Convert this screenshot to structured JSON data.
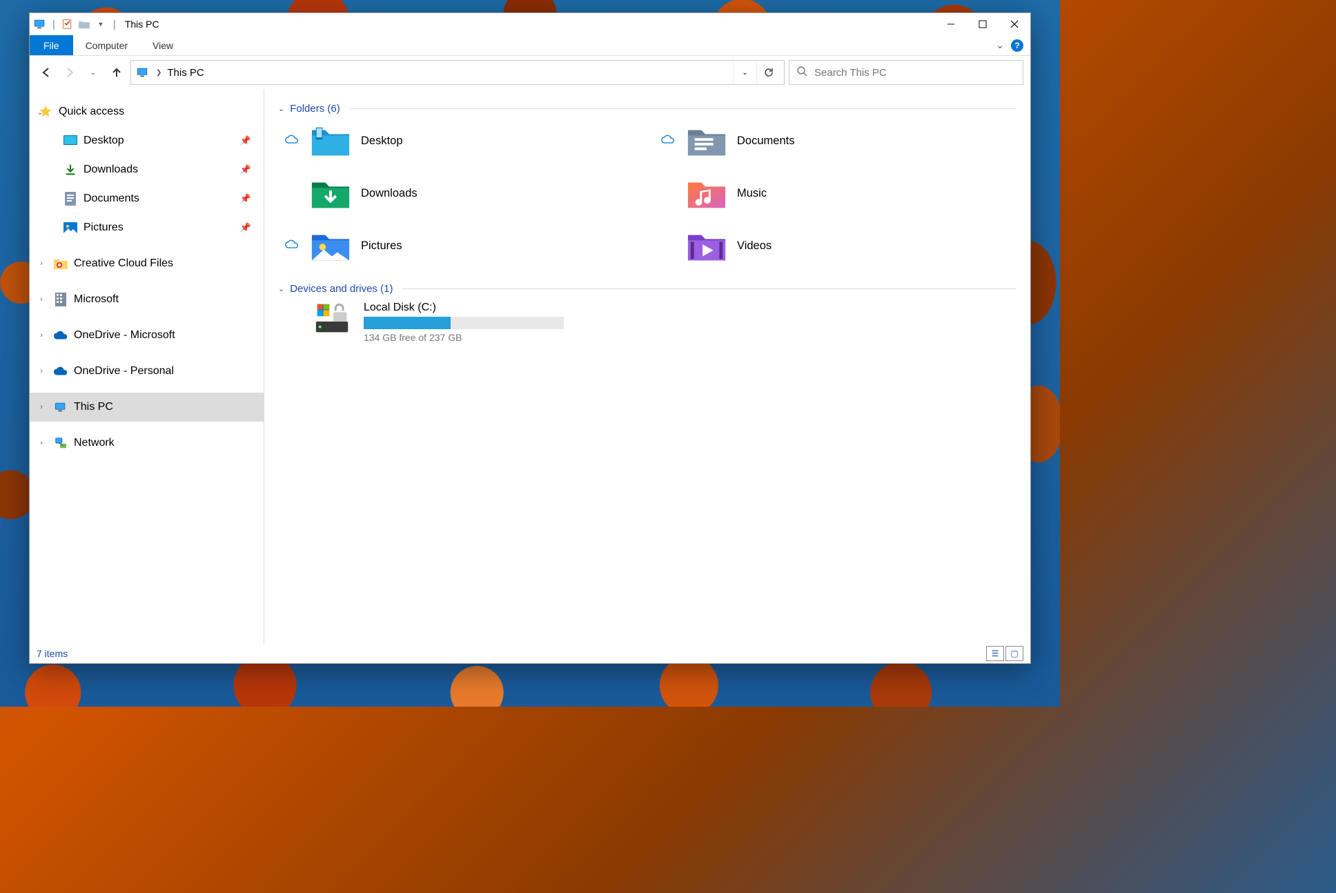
{
  "titlebar": {
    "title": "This PC"
  },
  "ribbon": {
    "file": "File",
    "tabs": [
      "Computer",
      "View"
    ]
  },
  "nav": {
    "breadcrumb": "This PC",
    "search_placeholder": "Search This PC"
  },
  "sidebar": {
    "quick_access": {
      "label": "Quick access",
      "items": [
        {
          "label": "Desktop",
          "icon": "desktop",
          "pinned": true
        },
        {
          "label": "Downloads",
          "icon": "downloads",
          "pinned": true
        },
        {
          "label": "Documents",
          "icon": "documents",
          "pinned": true
        },
        {
          "label": "Pictures",
          "icon": "pictures",
          "pinned": true
        }
      ]
    },
    "roots": [
      {
        "label": "Creative Cloud Files",
        "icon": "cc"
      },
      {
        "label": "Microsoft",
        "icon": "ms"
      },
      {
        "label": "OneDrive - Microsoft",
        "icon": "onedrive"
      },
      {
        "label": "OneDrive - Personal",
        "icon": "onedrive"
      },
      {
        "label": "This PC",
        "icon": "thispc",
        "selected": true
      },
      {
        "label": "Network",
        "icon": "network"
      }
    ]
  },
  "content": {
    "folders_header": "Folders (6)",
    "folders": [
      {
        "label": "Desktop",
        "icon": "desktop",
        "cloud": true
      },
      {
        "label": "Documents",
        "icon": "documents",
        "cloud": true
      },
      {
        "label": "Downloads",
        "icon": "downloads",
        "cloud": false
      },
      {
        "label": "Music",
        "icon": "music",
        "cloud": false
      },
      {
        "label": "Pictures",
        "icon": "pictures",
        "cloud": true
      },
      {
        "label": "Videos",
        "icon": "videos",
        "cloud": false
      }
    ],
    "drives_header": "Devices and drives (1)",
    "drives": [
      {
        "label": "Local Disk (C:)",
        "free_text": "134 GB free of 237 GB",
        "used_fraction": 0.435
      }
    ]
  },
  "statusbar": {
    "text": "7 items"
  }
}
